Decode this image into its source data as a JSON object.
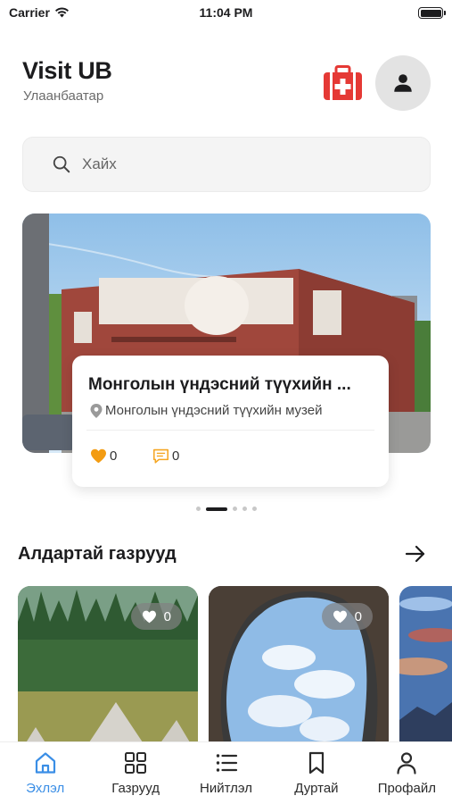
{
  "status_bar": {
    "carrier": "Carrier",
    "time": "11:04 PM"
  },
  "header": {
    "title": "Visit UB",
    "subtitle": "Улаанбаатар"
  },
  "search": {
    "placeholder": "Хайх"
  },
  "featured": {
    "title": "Монголын үндэсний түүхийн ...",
    "location": "Монголын үндэсний түүхийн музей",
    "likes": "0",
    "comments": "0",
    "page_index": 2,
    "page_count": 5
  },
  "popular": {
    "title": "Алдартай газрууд",
    "cards": [
      {
        "likes": "0"
      },
      {
        "likes": "0"
      }
    ]
  },
  "tabs": [
    {
      "label": "Эхлэл",
      "icon": "home-icon",
      "active": true
    },
    {
      "label": "Газрууд",
      "icon": "grid-icon"
    },
    {
      "label": "Нийтлэл",
      "icon": "list-icon"
    },
    {
      "label": "Дуртай",
      "icon": "bookmark-icon"
    },
    {
      "label": "Профайл",
      "icon": "user-icon"
    }
  ],
  "colors": {
    "accent": "#3a8ee6",
    "first_aid": "#e53935",
    "heart": "#f39c12",
    "comment": "#f5a623"
  }
}
